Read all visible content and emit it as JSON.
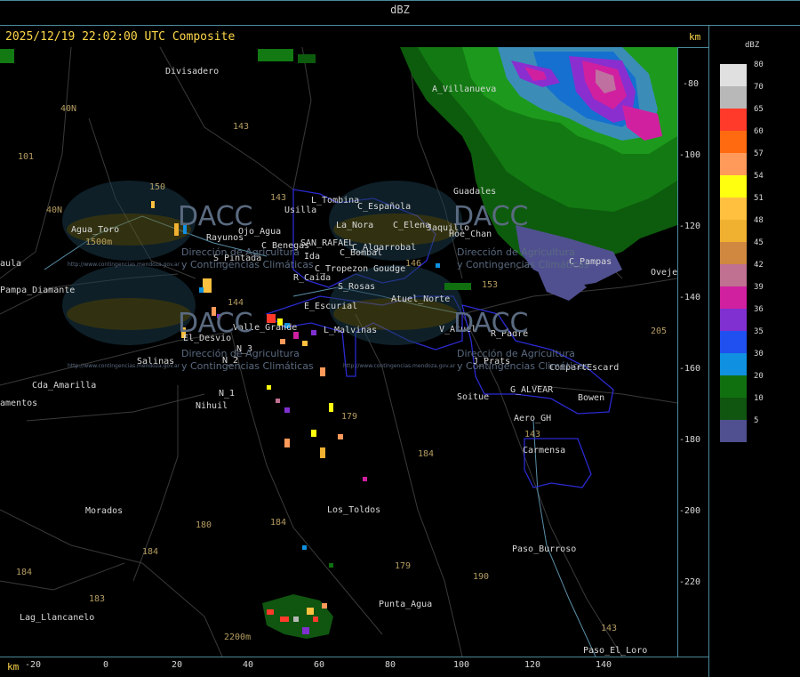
{
  "window": {
    "title": "dBZ"
  },
  "header": {
    "timestamp": "2025/12/19 22:02:00 UTC Composite"
  },
  "axes": {
    "x_unit": "km",
    "y_unit": "km",
    "x_ticks": [
      "-20",
      "0",
      "20",
      "40",
      "60",
      "80",
      "100",
      "120",
      "140"
    ],
    "y_ticks": [
      "-80",
      "-100",
      "-120",
      "-140",
      "-160",
      "-180",
      "-200",
      "-220"
    ]
  },
  "legend": {
    "title": "dBZ",
    "entries": [
      {
        "value": "80",
        "color": "#e0e0e0"
      },
      {
        "value": "70",
        "color": "#b8b8b8"
      },
      {
        "value": "65",
        "color": "#ff3a2a"
      },
      {
        "value": "60",
        "color": "#ff6a10"
      },
      {
        "value": "57",
        "color": "#ff9a5a"
      },
      {
        "value": "54",
        "color": "#ffff10"
      },
      {
        "value": "51",
        "color": "#ffc040"
      },
      {
        "value": "48",
        "color": "#f0b030"
      },
      {
        "value": "45",
        "color": "#d08840"
      },
      {
        "value": "42",
        "color": "#c07090"
      },
      {
        "value": "39",
        "color": "#d020a0"
      },
      {
        "value": "36",
        "color": "#8030d0"
      },
      {
        "value": "35",
        "color": "#2050f0"
      },
      {
        "value": "30",
        "color": "#1090e0"
      },
      {
        "value": "20",
        "color": "#107010"
      },
      {
        "value": "10",
        "color": "#105510"
      },
      {
        "value": "5",
        "color": "#505090"
      }
    ]
  },
  "places": [
    "Divisadero",
    "A_Villanueva",
    "Guadales",
    "L_Tombina",
    "Usilla",
    "C_Española",
    "La_Nora",
    "C_Elena",
    "Jaquillo",
    "Hoe_Chan",
    "Agua_Toro",
    "Pampa_Diamante",
    "Rayunos",
    "Ojo_Agua",
    "C_Benegas",
    "SAN_RAFAEL",
    "C_Algarrobal",
    "C_Bombal",
    "S_Pintada",
    "Ida",
    "C_Tropezon",
    "Goudge",
    "R_Caida",
    "S_Rosas",
    "Atuel_Norte",
    "E_Escurial",
    "Valle_Grande",
    "L_Malvinas",
    "V_Atuel",
    "R_Padre",
    "El_Desvio",
    "N_3",
    "N_2",
    "N_1",
    "Salinas",
    "Nihuil",
    "J_Prats",
    "CompartEscard",
    "Soitue",
    "G_ALVEAR",
    "Bowen",
    "Aero_GH",
    "Carmensa",
    "Cda_Amarilla",
    "amentos",
    "Morados",
    "Los_Toldos",
    "Paso_Burroso",
    "Punta_Agua",
    "Lag_Llancanelo",
    "Paso_El_Loro",
    "Oveje",
    "aula",
    "C_Pampas",
    "Soitue"
  ],
  "routes": [
    "40N",
    "143",
    "101",
    "40N",
    "150",
    "143",
    "144",
    "146",
    "179",
    "184",
    "180",
    "184",
    "184",
    "183",
    "179",
    "190",
    "143",
    "143",
    "205",
    "153",
    "1500m",
    "2200m"
  ],
  "watermark": {
    "brand": "DACC",
    "line1": "Dirección de Agricultura",
    "line2": "y Contingencias Climáticas",
    "url": "http://www.contingencias.mendoza.gov.ar"
  },
  "icons": [
    "radar-map",
    "dbz-colorbar"
  ]
}
